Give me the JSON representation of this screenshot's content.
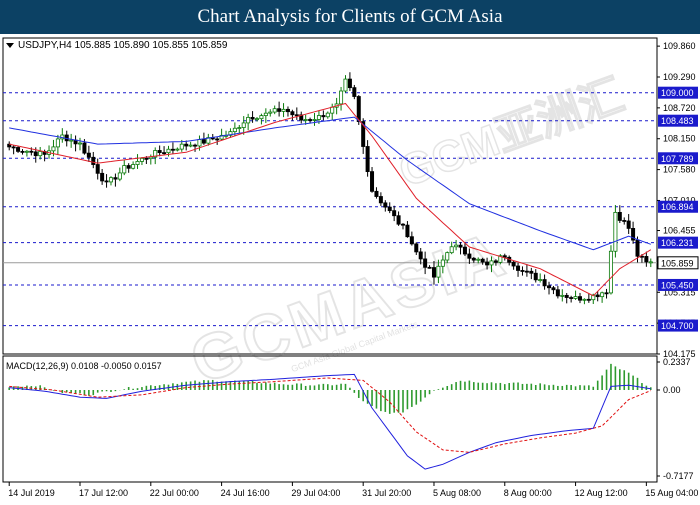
{
  "header": {
    "title": "Chart Analysis for Clients of GCM Asia"
  },
  "price_chart": {
    "symbol_info": "USDJPY,H4  105.885 105.890 105.855 105.859",
    "last_price_label": "105.859"
  },
  "macd": {
    "label": "MACD(12,26,9) 0.0108 -0.0050 0.0157"
  },
  "watermark": {
    "text": "GCMASIA",
    "subtext": "GCM Asia Global Capital Markets",
    "cn": "GCM亚洲汇"
  },
  "colors": {
    "title_bg": "#0c4164",
    "level_line": "#1a1acc",
    "level_label_bg": "#1a1acc",
    "ma_fast": "#e0202a",
    "ma_slow": "#2030e0",
    "bull": "#0a7a0a",
    "bear": "#000000",
    "hist": "#2e9a2e",
    "macd_line": "#2020dd",
    "signal_line": "#e01010"
  },
  "chart_data": [
    {
      "type": "candlestick",
      "title": "USDJPY,H4",
      "ylim": [
        104.175,
        110.01
      ],
      "y_ticks": [
        "109.860",
        "109.290",
        "108.720",
        "108.150",
        "107.580",
        "107.010",
        "106.455",
        "105.885",
        "105.315",
        "104.745",
        "104.175"
      ],
      "x_ticks": [
        "14 Jul 2019",
        "17 Jul 12:00",
        "22 Jul 00:00",
        "24 Jul 16:00",
        "29 Jul 04:00",
        "31 Jul 20:00",
        "5 Aug 08:00",
        "8 Aug 00:00",
        "12 Aug 12:00",
        "15 Aug 04:00"
      ],
      "levels": [
        {
          "value": 109.0,
          "label": "109.000"
        },
        {
          "value": 108.483,
          "label": "108.483"
        },
        {
          "value": 107.789,
          "label": "107.789"
        },
        {
          "value": 106.894,
          "label": "106.894"
        },
        {
          "value": 106.231,
          "label": "106.231"
        },
        {
          "value": 105.45,
          "label": "105.450"
        },
        {
          "value": 104.7,
          "label": "104.700"
        }
      ],
      "last_price": 105.859,
      "anchors": [
        [
          0,
          108.0
        ],
        [
          8,
          107.85
        ],
        [
          12,
          108.2
        ],
        [
          16,
          108.05
        ],
        [
          20,
          107.55
        ],
        [
          22,
          107.3
        ],
        [
          26,
          107.6
        ],
        [
          32,
          107.85
        ],
        [
          38,
          108.0
        ],
        [
          44,
          108.1
        ],
        [
          50,
          108.25
        ],
        [
          54,
          108.55
        ],
        [
          58,
          108.6
        ],
        [
          62,
          108.7
        ],
        [
          66,
          108.5
        ],
        [
          70,
          108.55
        ],
        [
          74,
          108.75
        ],
        [
          76,
          109.2
        ],
        [
          78,
          108.9
        ],
        [
          80,
          108.0
        ],
        [
          82,
          107.2
        ],
        [
          86,
          106.8
        ],
        [
          90,
          106.4
        ],
        [
          92,
          106.05
        ],
        [
          96,
          105.6
        ],
        [
          100,
          106.2
        ],
        [
          104,
          106.0
        ],
        [
          108,
          105.8
        ],
        [
          112,
          106.0
        ],
        [
          116,
          105.7
        ],
        [
          120,
          105.55
        ],
        [
          124,
          105.3
        ],
        [
          128,
          105.2
        ],
        [
          132,
          105.25
        ],
        [
          135,
          105.35
        ],
        [
          137,
          106.8
        ],
        [
          140,
          106.5
        ],
        [
          142,
          106.0
        ],
        [
          144,
          105.85
        ],
        [
          145,
          105.86
        ]
      ],
      "series": [
        {
          "name": "MA fast",
          "anchors": [
            [
              0,
              108.05
            ],
            [
              20,
              107.7
            ],
            [
              40,
              107.9
            ],
            [
              60,
              108.45
            ],
            [
              76,
              108.8
            ],
            [
              82,
              108.2
            ],
            [
              92,
              107.05
            ],
            [
              104,
              106.15
            ],
            [
              120,
              105.75
            ],
            [
              132,
              105.25
            ],
            [
              138,
              105.75
            ],
            [
              145,
              106.1
            ]
          ]
        },
        {
          "name": "MA slow",
          "anchors": [
            [
              0,
              108.35
            ],
            [
              20,
              108.05
            ],
            [
              40,
              108.1
            ],
            [
              60,
              108.35
            ],
            [
              78,
              108.55
            ],
            [
              90,
              107.75
            ],
            [
              104,
              106.95
            ],
            [
              120,
              106.45
            ],
            [
              132,
              106.1
            ],
            [
              140,
              106.35
            ],
            [
              145,
              106.2
            ]
          ]
        }
      ]
    },
    {
      "type": "macd",
      "title": "MACD(12,26,9)",
      "ylim": [
        -0.7177,
        0.2337
      ],
      "y_ticks": [
        "0.2337",
        "0.00",
        "-0.7177"
      ],
      "macd": 0.0108,
      "signal": -0.005,
      "histogram": 0.0157,
      "hist_anchors": [
        [
          0,
          0.03
        ],
        [
          6,
          0.04
        ],
        [
          12,
          -0.02
        ],
        [
          18,
          -0.04
        ],
        [
          24,
          0.0
        ],
        [
          30,
          0.03
        ],
        [
          38,
          0.06
        ],
        [
          46,
          0.08
        ],
        [
          54,
          0.07
        ],
        [
          62,
          0.05
        ],
        [
          70,
          0.04
        ],
        [
          76,
          0.05
        ],
        [
          80,
          -0.1
        ],
        [
          84,
          -0.18
        ],
        [
          88,
          -0.2
        ],
        [
          92,
          -0.12
        ],
        [
          96,
          0.0
        ],
        [
          102,
          0.08
        ],
        [
          110,
          0.06
        ],
        [
          118,
          0.05
        ],
        [
          126,
          0.04
        ],
        [
          132,
          0.03
        ],
        [
          136,
          0.21
        ],
        [
          140,
          0.14
        ],
        [
          145,
          0.02
        ]
      ],
      "macd_anchors": [
        [
          0,
          0.02
        ],
        [
          8,
          -0.01
        ],
        [
          16,
          -0.06
        ],
        [
          22,
          -0.07
        ],
        [
          30,
          -0.01
        ],
        [
          40,
          0.04
        ],
        [
          50,
          0.07
        ],
        [
          60,
          0.09
        ],
        [
          72,
          0.12
        ],
        [
          78,
          0.13
        ],
        [
          82,
          -0.15
        ],
        [
          86,
          -0.35
        ],
        [
          90,
          -0.55
        ],
        [
          94,
          -0.66
        ],
        [
          98,
          -0.62
        ],
        [
          104,
          -0.52
        ],
        [
          110,
          -0.44
        ],
        [
          118,
          -0.38
        ],
        [
          126,
          -0.34
        ],
        [
          132,
          -0.32
        ],
        [
          136,
          0.03
        ],
        [
          140,
          0.04
        ],
        [
          145,
          0.01
        ]
      ],
      "signal_anchors": [
        [
          0,
          0.03
        ],
        [
          10,
          0.0
        ],
        [
          20,
          -0.06
        ],
        [
          30,
          -0.04
        ],
        [
          40,
          0.02
        ],
        [
          50,
          0.05
        ],
        [
          60,
          0.07
        ],
        [
          72,
          0.1
        ],
        [
          80,
          0.08
        ],
        [
          86,
          -0.1
        ],
        [
          92,
          -0.35
        ],
        [
          98,
          -0.5
        ],
        [
          104,
          -0.52
        ],
        [
          112,
          -0.45
        ],
        [
          120,
          -0.4
        ],
        [
          128,
          -0.36
        ],
        [
          134,
          -0.3
        ],
        [
          140,
          -0.08
        ],
        [
          145,
          -0.005
        ]
      ]
    }
  ]
}
